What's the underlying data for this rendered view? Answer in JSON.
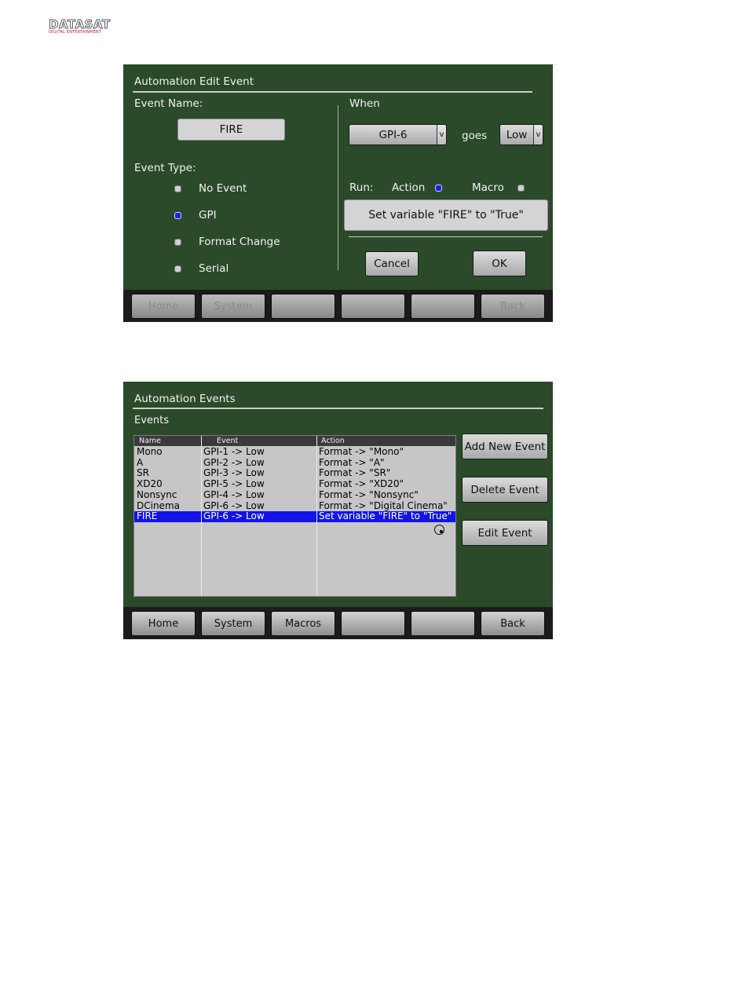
{
  "logo": {
    "name": "DATASAT",
    "tagline": "DIGITAL ENTERTAINMENT"
  },
  "edit_event": {
    "title": "Automation Edit Event",
    "event_name_label": "Event Name:",
    "event_name_value": "FIRE",
    "event_type_label": "Event Type:",
    "event_types": [
      {
        "label": "No Event",
        "selected": false
      },
      {
        "label": "GPI",
        "selected": true
      },
      {
        "label": "Format Change",
        "selected": false
      },
      {
        "label": "Serial",
        "selected": false
      }
    ],
    "when_label": "When",
    "gpi_select": "GPI-6",
    "dropdown_glyph": "v",
    "goes_label": "goes",
    "level_select": "Low",
    "run_label": "Run:",
    "run_action_label": "Action",
    "run_action_selected": true,
    "run_macro_label": "Macro",
    "run_macro_selected": false,
    "action_text": "Set variable \"FIRE\" to \"True\"",
    "cancel_label": "Cancel",
    "ok_label": "OK",
    "nav": [
      {
        "label": "Home",
        "enabled": false
      },
      {
        "label": "System",
        "enabled": false
      },
      {
        "label": "",
        "enabled": false
      },
      {
        "label": "",
        "enabled": false
      },
      {
        "label": "",
        "enabled": false
      },
      {
        "label": "Back",
        "enabled": false
      }
    ]
  },
  "events_screen": {
    "title": "Automation Events",
    "section_label": "Events",
    "columns": [
      "Name",
      "Event",
      "Action"
    ],
    "rows": [
      {
        "name": "Mono",
        "event": "GPI-1 -> Low",
        "action": "Format -> \"Mono\"",
        "selected": false
      },
      {
        "name": "A",
        "event": "GPI-2 -> Low",
        "action": "Format -> \"A\"",
        "selected": false
      },
      {
        "name": "SR",
        "event": "GPI-3 -> Low",
        "action": "Format -> \"SR\"",
        "selected": false
      },
      {
        "name": "XD20",
        "event": "GPI-5 -> Low",
        "action": "Format -> \"XD20\"",
        "selected": false
      },
      {
        "name": "Nonsync",
        "event": "GPI-4 -> Low",
        "action": "Format -> \"Nonsync\"",
        "selected": false
      },
      {
        "name": "DCinema",
        "event": "GPI-6 -> Low",
        "action": "Format -> \"Digital Cinema\"",
        "selected": false
      },
      {
        "name": "FIRE",
        "event": "GPI-6 -> Low",
        "action": "Set variable \"FIRE\" to \"True\"",
        "selected": true
      }
    ],
    "add_label": "Add New Event",
    "delete_label": "Delete Event",
    "edit_label": "Edit Event",
    "nav": [
      {
        "label": "Home",
        "enabled": true
      },
      {
        "label": "System",
        "enabled": true
      },
      {
        "label": "Macros",
        "enabled": true
      },
      {
        "label": "",
        "enabled": true
      },
      {
        "label": "",
        "enabled": true
      },
      {
        "label": "Back",
        "enabled": true
      }
    ]
  }
}
